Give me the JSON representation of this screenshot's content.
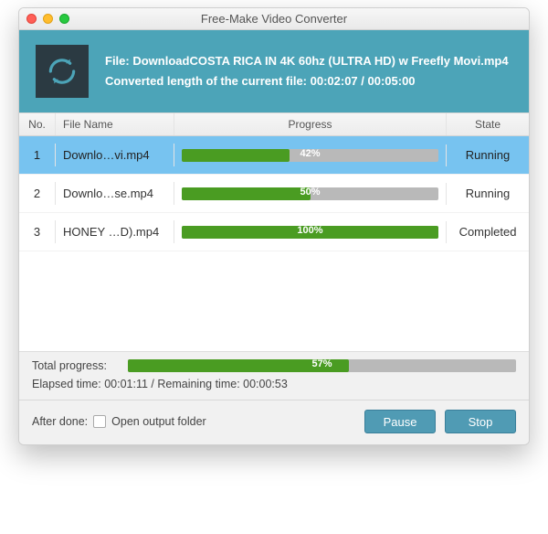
{
  "window": {
    "title": "Free-Make Video Converter"
  },
  "banner": {
    "line1": "File: DownloadCOSTA RICA IN 4K 60hz (ULTRA HD) w Freefly Movi.mp4",
    "line2": "Converted length of the current file: 00:02:07 / 00:05:00"
  },
  "headers": {
    "no": "No.",
    "name": "File Name",
    "progress": "Progress",
    "state": "State"
  },
  "rows": [
    {
      "no": "1",
      "name": "Downlo…vi.mp4",
      "progress": 42,
      "progress_label": "42%",
      "state": "Running",
      "selected": true
    },
    {
      "no": "2",
      "name": "Downlo…se.mp4",
      "progress": 50,
      "progress_label": "50%",
      "state": "Running",
      "selected": false
    },
    {
      "no": "3",
      "name": "HONEY …D).mp4",
      "progress": 100,
      "progress_label": "100%",
      "state": "Completed",
      "selected": false
    }
  ],
  "total": {
    "label": "Total progress:",
    "progress": 57,
    "progress_label": "57%"
  },
  "time": {
    "text": "Elapsed time: 00:01:11 / Remaining time: 00:00:53"
  },
  "after": {
    "label": "After done:",
    "checkbox_label": "Open output folder",
    "checked": false
  },
  "buttons": {
    "pause": "Pause",
    "stop": "Stop"
  }
}
